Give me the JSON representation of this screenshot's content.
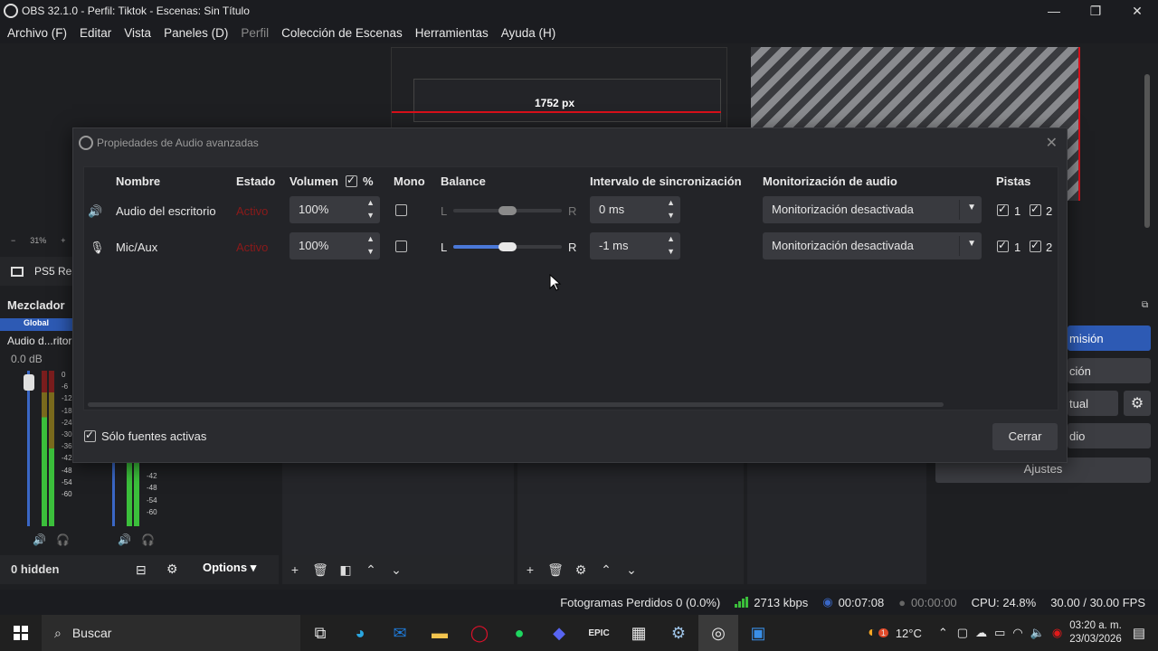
{
  "window": {
    "title": "OBS 32.1.0 - Perfil: Tiktok - Escenas: Sin Título",
    "controls": [
      "—",
      "❐",
      "✕"
    ]
  },
  "menu": {
    "items": [
      "Archivo (F)",
      "Editar",
      "Vista",
      "Paneles (D)",
      "Perfil",
      "Colección de Escenas",
      "Herramientas",
      "Ayuda (H)"
    ]
  },
  "preview": {
    "px_label": "1752 px",
    "zoom": "31%"
  },
  "scenes": {
    "current_label": "PS5 Re"
  },
  "mixer": {
    "title": "Mezclador",
    "global_tab": "Global",
    "source_name": "Audio d...ritor",
    "db_value": "0.0 dB",
    "scale": [
      "0",
      "-6",
      "-12",
      "-18",
      "-24",
      "-30",
      "-36",
      "-42",
      "-48",
      "-54",
      "-60"
    ],
    "scale2": [
      "-42",
      "-48",
      "-54",
      "-60"
    ],
    "hidden_label": "0 hidden",
    "options_label": "Options"
  },
  "controls": {
    "stream_label": "misión",
    "record_label": "ción",
    "virtual_label": "tual",
    "studio_label": "dio",
    "settings_label": "Ajustes"
  },
  "status": {
    "dropped": "Fotogramas Perdidos 0 (0.0%)",
    "bitrate": "2713 kbps",
    "stream_time": "00:07:08",
    "rec_time": "00:00:00",
    "cpu": "CPU: 24.8%",
    "fps": "30.00 / 30.00 FPS"
  },
  "dialog": {
    "title": "Propiedades de Audio avanzadas",
    "headers": {
      "nombre": "Nombre",
      "estado": "Estado",
      "volumen": "Volumen",
      "percent": "%",
      "mono": "Mono",
      "balance": "Balance",
      "sync": "Intervalo de sincronización",
      "monitor": "Monitorización de audio",
      "pistas": "Pistas"
    },
    "rows": [
      {
        "name": "Audio del escritorio",
        "status": "Activo",
        "volume": "100%",
        "mono": false,
        "balance_l": "L",
        "balance_r": "R",
        "balance": 0.5,
        "sync": "0 ms",
        "monitor": "Monitorización desactivada",
        "track1": "1",
        "track2": "2"
      },
      {
        "name": "Mic/Aux",
        "status": "Activo",
        "volume": "100%",
        "mono": false,
        "balance_l": "L",
        "balance_r": "R",
        "balance": 0.5,
        "sync": "-1 ms",
        "monitor": "Monitorización desactivada",
        "track1": "1",
        "track2": "2"
      }
    ],
    "only_active_label": "Sólo fuentes activas",
    "close_label": "Cerrar"
  },
  "taskbar": {
    "search_placeholder": "Buscar",
    "weather_temp": "12°C",
    "weather_badge": "1",
    "time": "03:20 a. m.",
    "date": "23/03/2026"
  },
  "colors": {
    "accent_blue": "#2d5ab4",
    "status_inactive_red": "#8b1a1a",
    "meter_green": "#3bbf3b",
    "recording_red": "#d8101a"
  }
}
